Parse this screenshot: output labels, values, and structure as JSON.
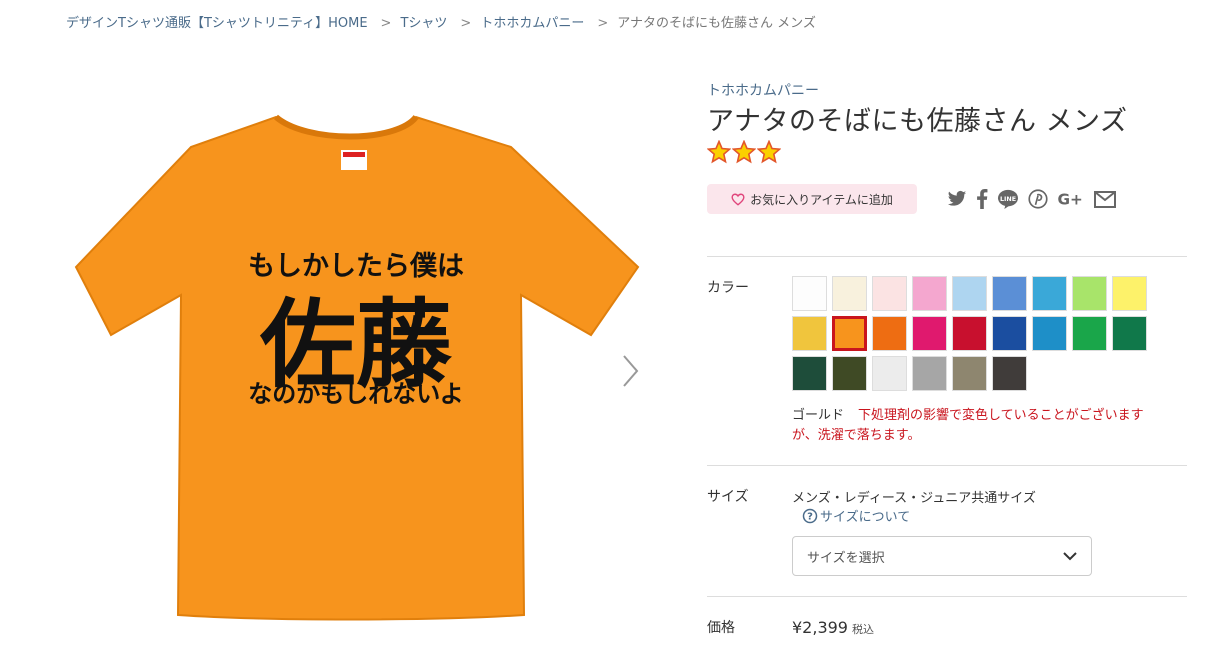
{
  "breadcrumb": {
    "home": "デザインTシャツ通販【Tシャツトリニティ】HOME",
    "category": "Tシャツ",
    "shop": "トホホカムパニー",
    "current": "アナタのそばにも佐藤さん メンズ"
  },
  "product_image": {
    "shirt_color": "#f7941d",
    "print_line1": "もしかしたら僕は",
    "print_main": "佐藤",
    "print_line3": "なのかもしれないよ"
  },
  "product": {
    "brand": "トホホカムパニー",
    "title": "アナタのそばにも佐藤さん メンズ",
    "star_count": 3
  },
  "actions": {
    "favorite_label": "お気に入りアイテムに追加",
    "share_icons": [
      "twitter-icon",
      "facebook-icon",
      "line-icon",
      "pinterest-icon",
      "google-plus-icon",
      "mail-icon"
    ]
  },
  "color_section": {
    "label": "カラー",
    "swatches": [
      "#fdfdfd",
      "#f8f1dd",
      "#fbe3e3",
      "#f4a7cf",
      "#aed5f0",
      "#5b8fd6",
      "#3aa8d8",
      "#a8e46a",
      "#fdf26a",
      "#f0c53d",
      "#f7941d",
      "#ee6d12",
      "#e0196e",
      "#c8102e",
      "#1b4ea0",
      "#1e8fc8",
      "#1aa64a",
      "#10784a",
      "#1e4d3a",
      "#3f4a25",
      "#ececec",
      "#a6a6a6",
      "#8e866f",
      "#403c3a"
    ],
    "selected_index": 10,
    "selected_name": "ゴールド",
    "note": "下処理剤の影響で変色していることがございますが、洗濯で落ちます。"
  },
  "size_section": {
    "label": "サイズ",
    "description": "メンズ・レディース・ジュニア共通サイズ",
    "link": "サイズについて",
    "select_placeholder": "サイズを選択"
  },
  "price_section": {
    "label": "価格",
    "amount": "¥2,399",
    "tax_note": "税込"
  }
}
